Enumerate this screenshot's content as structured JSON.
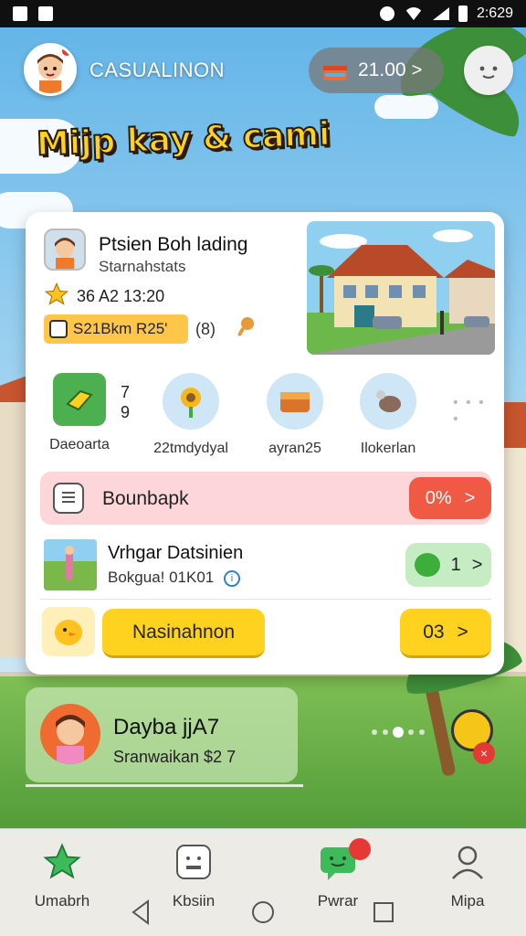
{
  "status_bar": {
    "left_icons": [
      "notification-icon",
      "sim-icon"
    ],
    "right_icons": [
      "settings-icon",
      "wifi-icon",
      "signal-icon",
      "battery-icon"
    ],
    "time": "2:629"
  },
  "header": {
    "app_name": "CASUALINON",
    "coin_value": "21.00",
    "coin_arrow": ">",
    "logo_text": "Mijp kay & cami"
  },
  "profile": {
    "name": "Ptsien Boh lading",
    "subtitle": "Starnahstats",
    "stat": "36 A2 13:20",
    "badge_text": "S21Bkm R25'",
    "extra": "(8)"
  },
  "icons_row": {
    "items": [
      {
        "label": "Daeoarta",
        "icon": "ticket-icon"
      },
      {
        "label": "22tmdydyal",
        "icon": "sunflower-icon"
      },
      {
        "label": "ayran25",
        "icon": "wallet-icon"
      },
      {
        "label": "Ilokerlan",
        "icon": "tools-icon"
      }
    ],
    "numbers": [
      "7",
      "9"
    ],
    "dots": "• • • •"
  },
  "row_pink": {
    "label": "Bounbapk",
    "pill_value": "0%",
    "arrow": ">"
  },
  "row_news": {
    "title": "Vrhgar Datsinien",
    "subtitle": "Bokgua! 01K01",
    "info": "i",
    "pill_value": "1",
    "arrow": ">"
  },
  "row_yellow": {
    "button_label": "Nasinahnon",
    "small_value": "03",
    "arrow": ">"
  },
  "lower_card": {
    "title": "Dayba jjA7",
    "subtitle": "Sranwaikan $2 7",
    "badge_x": "×"
  },
  "bottom_nav": [
    {
      "label": "Umabrh",
      "icon": "star-icon"
    },
    {
      "label": "Kbsiin",
      "icon": "box-face-icon"
    },
    {
      "label": "Pwrar",
      "icon": "chat-icon"
    },
    {
      "label": "Mipa",
      "icon": "person-icon"
    }
  ],
  "colors": {
    "accent_yellow": "#ffd21f",
    "accent_red": "#f05a44",
    "accent_green": "#4caf50",
    "pink_row": "#fcd6d9"
  }
}
